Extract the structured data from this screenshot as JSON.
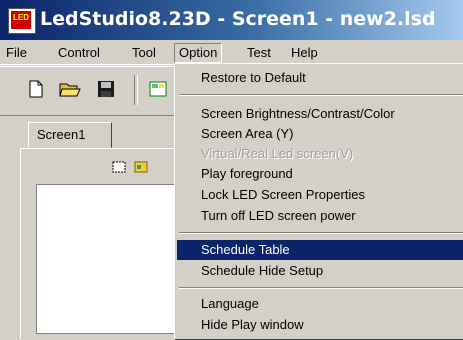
{
  "window": {
    "title": "LedStudio8.23D - Screen1 - new2.lsd",
    "icon_text": "LED"
  },
  "menubar": [
    {
      "label": "File"
    },
    {
      "label": "Control"
    },
    {
      "label": "Tool"
    },
    {
      "label": "Option"
    },
    {
      "label": "Test"
    },
    {
      "label": "Help"
    }
  ],
  "toolbar": {
    "icons": [
      "new-file-icon",
      "open-folder-icon",
      "save-icon",
      "screen-icon"
    ]
  },
  "document": {
    "tab_label": "Screen1",
    "panel_icons": [
      "small-frame-icon",
      "small-image-icon"
    ]
  },
  "option_menu": {
    "items": [
      {
        "label": "Restore to Default"
      },
      {
        "label": "Screen Brightness/Contrast/Color"
      },
      {
        "label": "Screen Area (Y)"
      },
      {
        "label": "Virtual/Real Led screen(V)",
        "state": "disabled"
      },
      {
        "label": "Play foreground"
      },
      {
        "label": "Lock LED Screen Properties"
      },
      {
        "label": "Turn off LED screen power"
      },
      {
        "label": "Schedule Table",
        "state": "selected"
      },
      {
        "label": "Schedule Hide Setup"
      },
      {
        "label": "Language",
        "submenu": true
      },
      {
        "label": "Hide Play window"
      }
    ]
  },
  "colors": {
    "highlight": "#0a246a",
    "title_gradient_start": "#0a246a",
    "title_gradient_end": "#a6caf0",
    "face": "#d4d0c8"
  }
}
